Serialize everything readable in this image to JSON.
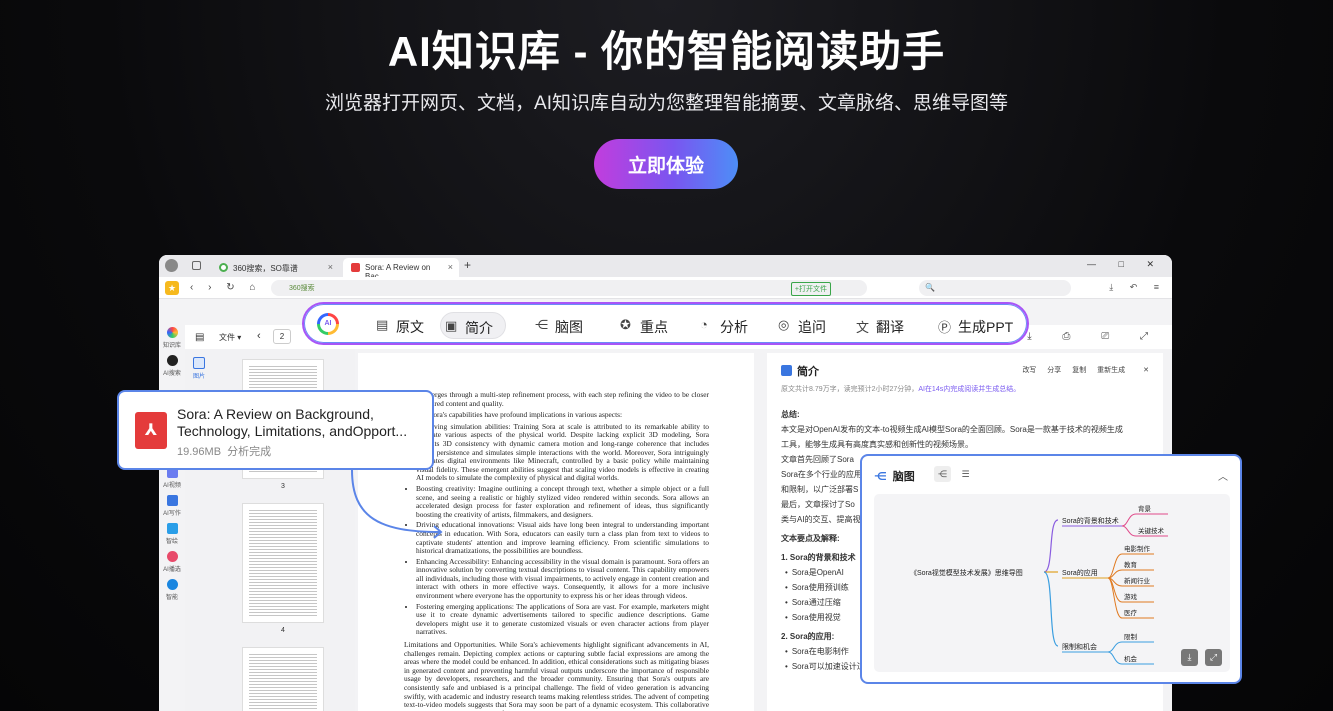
{
  "hero": {
    "title": "AI知识库 - 你的智能阅读助手",
    "subtitle": "浏览器打开网页、文档，AI知识库自动为您整理智能摘要、文章脉络、思维导图等",
    "cta": "立即体验"
  },
  "browser": {
    "tabs": [
      {
        "label": "360搜索，SO靠谱",
        "close": "×"
      },
      {
        "label": "Sora: A Review on Bac...",
        "close": "×"
      }
    ],
    "new_tab": "+",
    "window_controls": "— □ ✕",
    "nav_glyphs": "‹ › ↻ ⌂",
    "url_text": "360搜索",
    "url_tag": "+打开文件",
    "search_glyph": "🔍",
    "right_glyphs": "⤓ ↶ ≡"
  },
  "leftbar": {
    "items": [
      "知识库",
      "AI搜索",
      "AI视频",
      "AI写作",
      "智绘",
      "AI播选",
      "智能"
    ]
  },
  "pdf_toolbar": {
    "file_menu": "文件 ▾",
    "prev": "‹",
    "page": "2",
    "right_glyphs": "⤓ ⎙ ⎚ ⤢"
  },
  "thumbs": {
    "side_label": "图片",
    "labels": [
      "3",
      "4"
    ]
  },
  "document": {
    "p1": "video emerges through a multi-step refinement process, with each step refining the video to be closer to the desired content and quality.",
    "p2": "of Sora. Sora's capabilities have profound implications in various aspects:",
    "bullets": [
      "Improving simulation abilities: Training Sora at scale is attributed to its remarkable ability to simulate various aspects of the physical world. Despite lacking explicit 3D modeling, Sora exhibits 3D consistency with dynamic camera motion and long-range coherence that includes object persistence and simulates simple interactions with the world. Moreover, Sora intriguingly simulates digital environments like Minecraft, controlled by a basic policy while maintaining visual fidelity. These emergent abilities suggest that scaling video models is effective in creating AI models to simulate the complexity of physical and digital worlds.",
      "Boosting creativity: Imagine outlining a concept through text, whether a simple object or a full scene, and seeing a realistic or highly stylized video rendered within seconds. Sora allows an accelerated design process for faster exploration and refinement of ideas, thus significantly boosting the creativity of artists, filmmakers, and designers.",
      "Driving educational innovations: Visual aids have long been integral to understanding important concepts in education. With Sora, educators can easily turn a class plan from text to videos to captivate students' attention and improve learning efficiency. From scientific simulations to historical dramatizations, the possibilities are boundless.",
      "Enhancing Accessibility: Enhancing accessibility in the visual domain is paramount. Sora offers an innovative solution by converting textual descriptions to visual content. This capability empowers all individuals, including those with visual impairments, to actively engage in content creation and interact with others in more effective ways. Consequently, it allows for a more inclusive environment where everyone has the opportunity to express his or her ideas through videos.",
      "Fostering emerging applications: The applications of Sora are vast. For example, marketers might use it to create dynamic advertisements tailored to specific audience descriptions. Game developers might use it to generate customized visuals or even character actions from player narratives."
    ],
    "p3": "Limitations and Opportunities. While Sora's achievements highlight significant advancements in AI, challenges remain. Depicting complex actions or capturing subtle facial expressions are among the areas where the model could be enhanced. In addition, ethical considerations such as mitigating biases in generated content and preventing harmful visual outputs underscore the importance of responsible usage by developers, researchers, and the broader community. Ensuring that Sora's outputs are consistently safe and unbiased is a principal challenge. The field of video generation is advancing swiftly, with academic and industry research teams making relentless strides. The advent of competing text-to-video models suggests that Sora may soon be part of a dynamic ecosystem. This collaborative and competitive environment fosters innovation, leading to improved video quality and new applications that help improve the productivity"
  },
  "summary": {
    "title": "简介",
    "actions": [
      "改写",
      "分享",
      "复制",
      "重新生成",
      "✕"
    ],
    "meta": "原文共计8.79万字，读完预计2小时27分钟，",
    "meta_highlight": "AI在14s内完成阅读并生成总结。",
    "lines": [
      {
        "t": "总结:",
        "k": "h"
      },
      {
        "t": "本文是对OpenAI发布的文本-to视频生成AI模型Sora的全面回顾。Sora是一款基于技术的视频生成",
        "k": "p"
      },
      {
        "t": "工具，能够生成具有高度真实感和创新性的视频场景。",
        "k": "p"
      },
      {
        "t": "文章首先回顾了Sora",
        "k": "p"
      },
      {
        "t": "Sora在多个行业的应用",
        "k": "p"
      },
      {
        "t": "和限制，以广泛部署S",
        "k": "p"
      },
      {
        "t": "最后，文章探讨了So",
        "k": "p"
      },
      {
        "t": "类与AI的交互、提高视",
        "k": "p"
      },
      {
        "t": "文本要点及解释:",
        "k": "h"
      },
      {
        "t": "1. Sora的背景和技术",
        "k": "h"
      },
      {
        "t": "Sora是OpenAI",
        "k": "b"
      },
      {
        "t": "Sora使用预训练",
        "k": "b"
      },
      {
        "t": "Sora通过压缩",
        "k": "b"
      },
      {
        "t": "Sora使用视觉",
        "k": "b"
      },
      {
        "t": "2. Sora的应用:",
        "k": "h"
      },
      {
        "t": "Sora在电影制作",
        "k": "b"
      },
      {
        "t": "Sora可以加速设计过程，提高艺术家、电影制片人和设计师的创造力。",
        "k": "b"
      }
    ]
  },
  "ai_toolbar": {
    "items": [
      {
        "label": "原文",
        "glyph": "▤"
      },
      {
        "label": "简介",
        "glyph": "▣"
      },
      {
        "label": "脑图",
        "glyph": "⋲"
      },
      {
        "label": "重点",
        "glyph": "✪"
      },
      {
        "label": "分析",
        "glyph": "◔"
      },
      {
        "label": "追问",
        "glyph": "◎"
      },
      {
        "label": "翻译",
        "glyph": "文"
      },
      {
        "label": "生成PPT",
        "glyph": "Ⓟ"
      }
    ]
  },
  "file_card": {
    "title": "Sora: A Review on Background, Technology, Limitations, andOpport...",
    "size": "19.96MB",
    "status": "分析完成"
  },
  "mindmap": {
    "title": "脑图",
    "root": "《Sora视觉模型技术发展》思维导图",
    "branches": [
      {
        "label": "Sora的背景和技术",
        "leaves": [
          "背景",
          "关键技术"
        ]
      },
      {
        "label": "Sora的应用",
        "leaves": [
          "电影制作",
          "教育",
          "新闻行业",
          "游戏",
          "医疗"
        ]
      },
      {
        "label": "限制和机会",
        "leaves": [
          "限制",
          "机会"
        ]
      }
    ]
  },
  "colors": {
    "accent": "#5b85e8",
    "cta_start": "#c23ddd",
    "cta_end": "#4d8ef7",
    "toolbar_border": "#a855f7"
  }
}
